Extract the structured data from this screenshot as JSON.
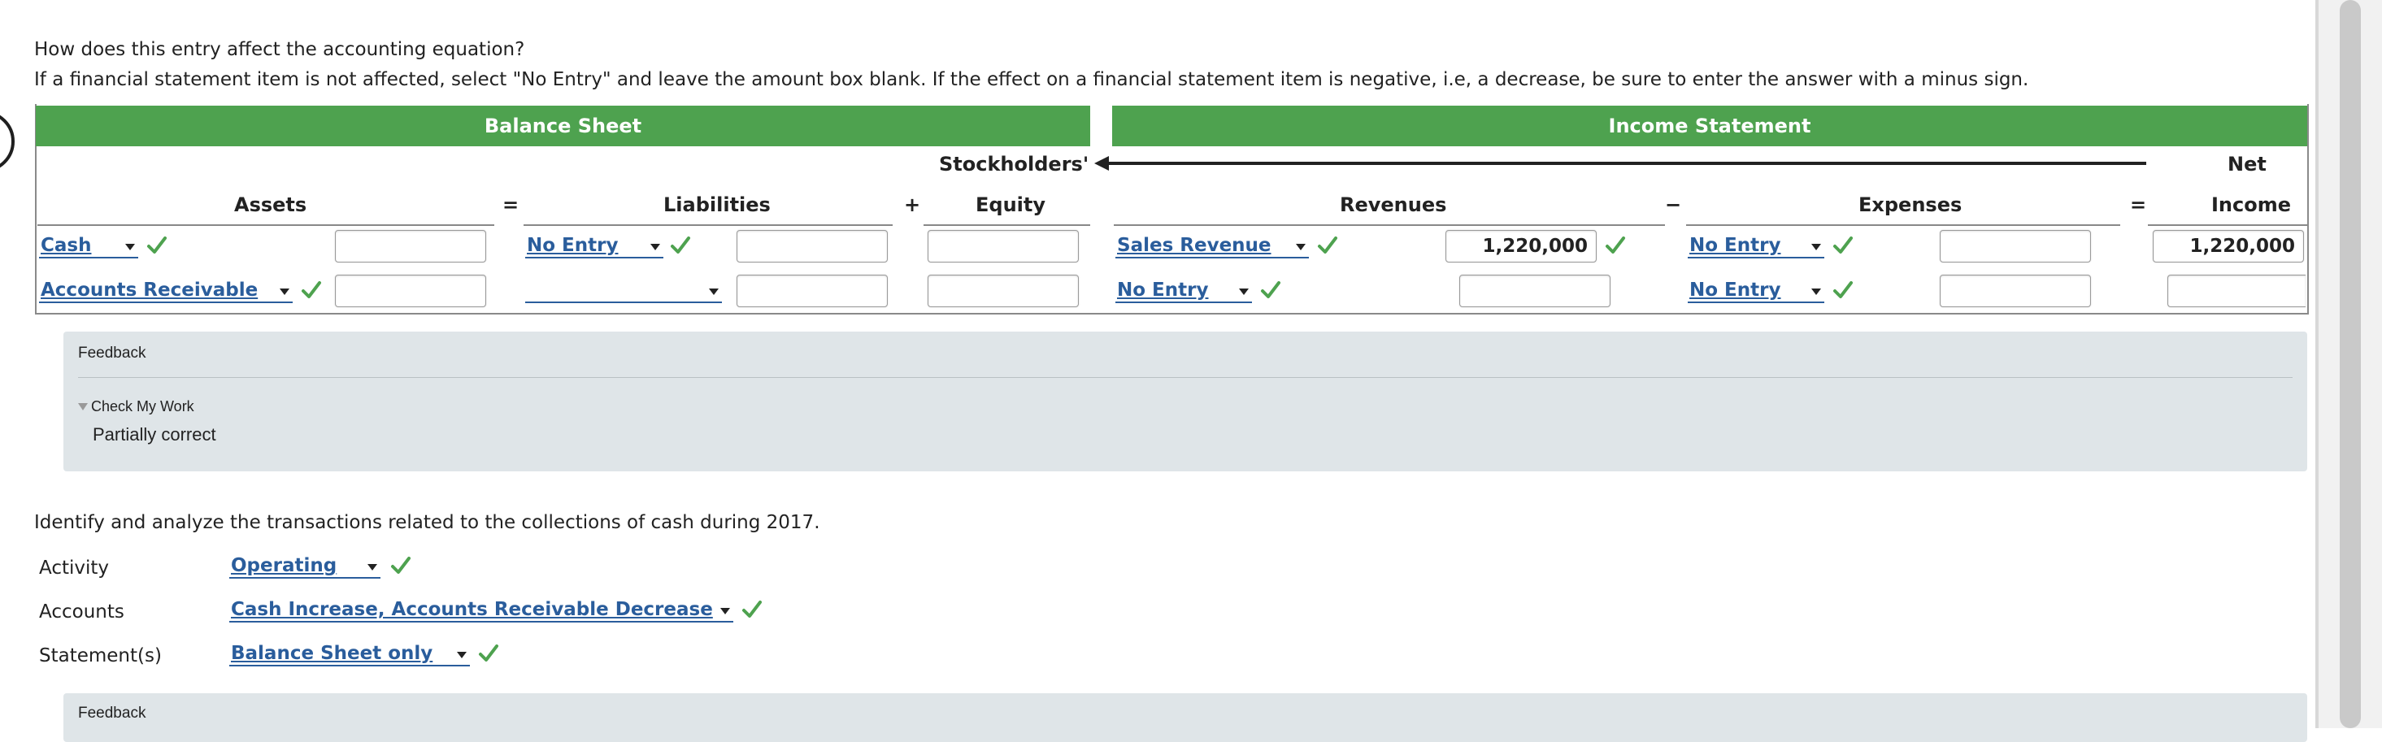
{
  "question": {
    "line1": "How does this entry affect the accounting equation?",
    "line2": "If a financial statement item is not affected, select \"No Entry\" and leave the amount box blank. If the effect on a financial statement item is negative, i.e, a decrease, be sure to enter the answer with a minus sign."
  },
  "table": {
    "balance_sheet_header": "Balance Sheet",
    "income_statement_header": "Income Statement",
    "stockholders_top": "Stockholders'",
    "net_top": "Net",
    "col_assets": "Assets",
    "col_liabilities": "Liabilities",
    "col_equity": "Equity",
    "col_revenues": "Revenues",
    "col_expenses": "Expenses",
    "col_income": "Income",
    "op_eq1": "=",
    "op_plus": "+",
    "op_minus": "−",
    "op_eq2": "=",
    "rows": [
      {
        "asset_account": "Cash",
        "asset_amount": "",
        "liability_account": "No Entry",
        "liability_amount": "",
        "equity_amount": "",
        "revenue_account": "Sales Revenue",
        "revenue_amount": "1,220,000",
        "expense_account": "No Entry",
        "expense_amount": "",
        "net_income": "1,220,000"
      },
      {
        "asset_account": "Accounts Receivable",
        "asset_amount": "",
        "liability_account": "",
        "liability_amount": "",
        "equity_amount": "",
        "revenue_account": "No Entry",
        "revenue_amount": "",
        "expense_account": "No Entry",
        "expense_amount": "",
        "net_income": ""
      }
    ]
  },
  "feedback1": {
    "title": "Feedback",
    "check_my_work": "Check My Work",
    "result": "Partially correct"
  },
  "analysis": {
    "prompt": "Identify and analyze the transactions related to the collections of cash during 2017.",
    "activity_label": "Activity",
    "activity_value": "Operating",
    "accounts_label": "Accounts",
    "accounts_value": "Cash Increase, Accounts Receivable Decrease",
    "statements_label": "Statement(s)",
    "statements_value": "Balance Sheet only"
  },
  "feedback2": {
    "title": "Feedback"
  },
  "colors": {
    "header_green": "#4ea24f",
    "check_green": "#4ea24f",
    "link_blue": "#2a5d9c",
    "feedback_bg": "#dfe5e8"
  }
}
